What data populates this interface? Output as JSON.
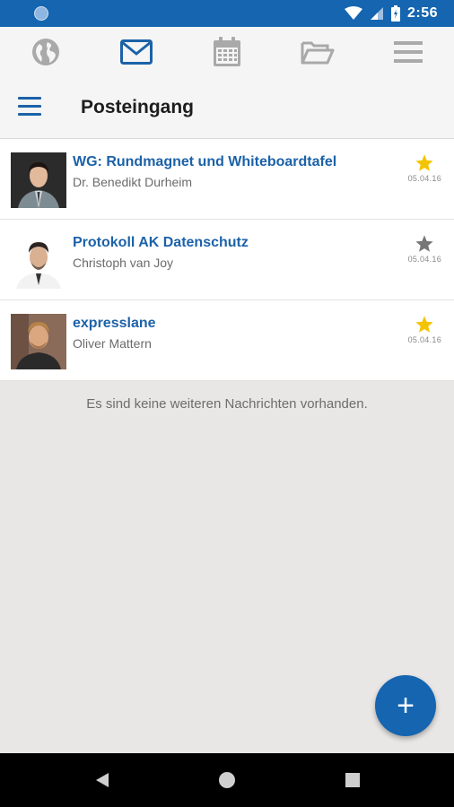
{
  "status_bar": {
    "time": "2:56",
    "background": "#1565b0"
  },
  "tabs": [
    {
      "name": "globe-icon",
      "active": false
    },
    {
      "name": "mail-icon",
      "active": true
    },
    {
      "name": "calendar-icon",
      "active": false
    },
    {
      "name": "folder-icon",
      "active": false
    },
    {
      "name": "menu-lines-icon",
      "active": false
    }
  ],
  "header": {
    "title": "Posteingang"
  },
  "messages": [
    {
      "subject": "WG: Rundmagnet und Whiteboardtafel",
      "sender": "Dr. Benedikt Durheim",
      "date": "05.04.16",
      "starred": true
    },
    {
      "subject": "Protokoll AK Datenschutz",
      "sender": "Christoph van Joy",
      "date": "05.04.16",
      "starred": false
    },
    {
      "subject": "expresslane",
      "sender": "Oliver Mattern",
      "date": "05.04.16",
      "starred": true
    }
  ],
  "empty_note": "Es sind keine weiteren Nachrichten vorhanden.",
  "fab": {
    "label": "+"
  },
  "colors": {
    "accent": "#1565b0",
    "link": "#1c62a8",
    "star_on": "#f5c400",
    "star_off": "#777777",
    "icon_inactive": "#a9a9a9"
  }
}
